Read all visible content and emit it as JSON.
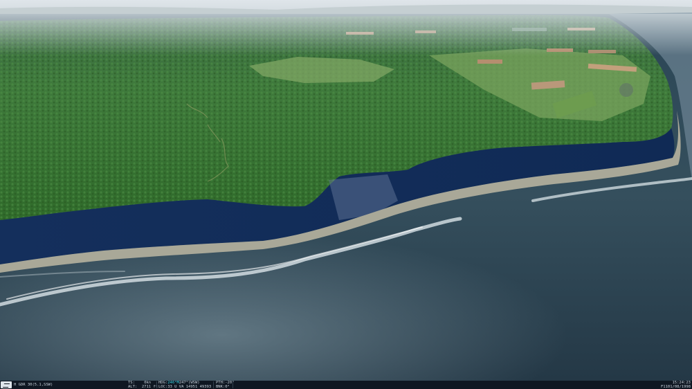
{
  "hud": {
    "map_grid": "H GDR 30(5.1,SSW)",
    "ts_label": "TS:",
    "ts_value": "0kn",
    "alt_label": "ALT:",
    "alt_value": "2711 ft",
    "hdg_label": "HDG:",
    "hdg_value": "246°M",
    "hdg_extra": "247°(WSW)",
    "loc_label": "LOC:",
    "loc_value": "33 U VA 14951 49393",
    "pth_label": "PTH:",
    "pth_value": "-20°",
    "bnk_label": "BNK:",
    "bnk_value": "0°",
    "time": "15:24:23",
    "date": "F1101/08/1998",
    "accent_color": "#39d7e8"
  }
}
